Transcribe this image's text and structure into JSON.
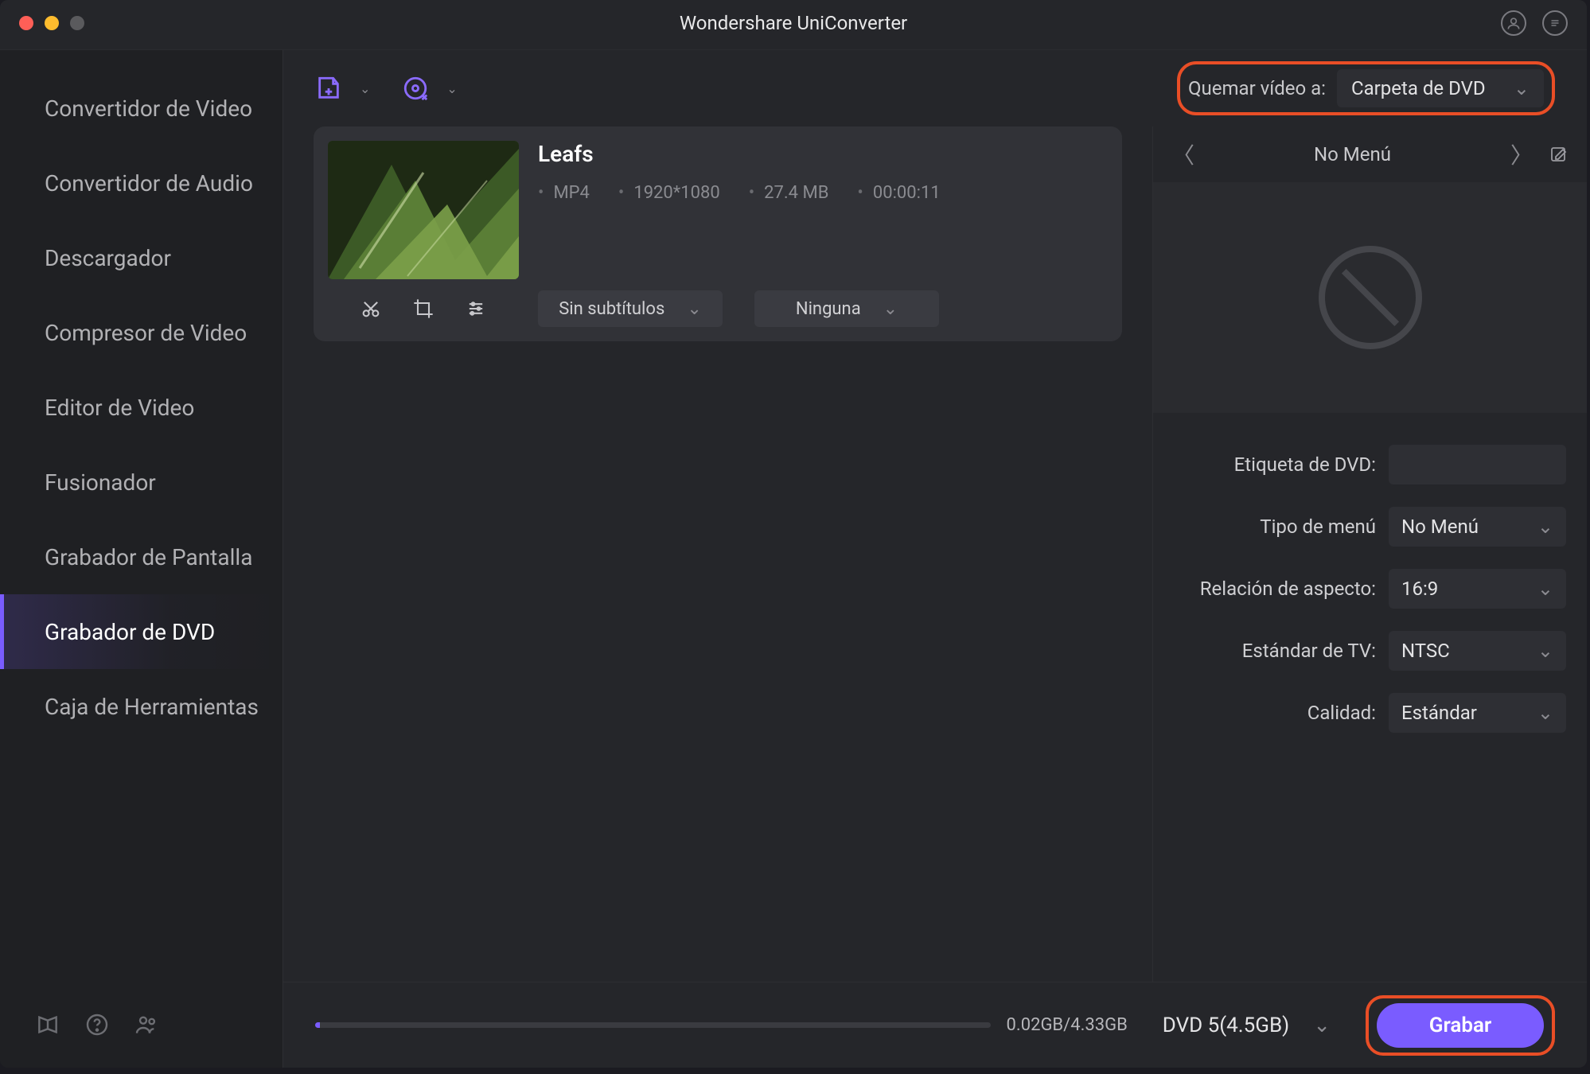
{
  "titlebar": {
    "title": "Wondershare UniConverter"
  },
  "sidebar": {
    "items": [
      {
        "label": "Convertidor de Video"
      },
      {
        "label": "Convertidor de Audio"
      },
      {
        "label": "Descargador"
      },
      {
        "label": "Compresor de Video"
      },
      {
        "label": "Editor de Video"
      },
      {
        "label": "Fusionador"
      },
      {
        "label": "Grabador de Pantalla"
      },
      {
        "label": "Grabador de DVD"
      },
      {
        "label": "Caja de Herramientas"
      }
    ],
    "activeIndex": 7
  },
  "toprow": {
    "burnLabel": "Quemar vídeo a:",
    "burnTarget": "Carpeta de DVD"
  },
  "file": {
    "title": "Leafs",
    "format": "MP4",
    "resolution": "1920*1080",
    "size": "27.4 MB",
    "duration": "00:00:11",
    "subtitleSelect": "Sin subtítulos",
    "audioSelect": "Ninguna"
  },
  "menuNav": {
    "label": "No Menú"
  },
  "settings": {
    "dvdLabelLabel": "Etiqueta de DVD:",
    "dvdLabelValue": "",
    "menuTypeLabel": "Tipo de menú",
    "menuTypeValue": "No Menú",
    "aspectLabel": "Relación de aspecto:",
    "aspectValue": "16:9",
    "tvStdLabel": "Estándar de TV:",
    "tvStdValue": "NTSC",
    "qualityLabel": "Calidad:",
    "qualityValue": "Estándar"
  },
  "footer": {
    "progressText": "0.02GB/4.33GB",
    "discType": "DVD 5(4.5GB)",
    "burnBtn": "Grabar"
  }
}
